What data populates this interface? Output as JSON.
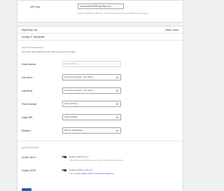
{
  "api": {
    "label": "API Key",
    "value": "xxxxxxxxxx12345 api-key-us1",
    "help": "Enter a MailChimp API key. You can create keys in your MailChimp account."
  },
  "list_panel": {
    "header_left": "MailChimp List",
    "header_right": "Fields Count",
    "list_name": "Monthly IT Newsletter"
  },
  "mapping": {
    "section_title": "MAP CUSTOM FIELDS",
    "section_sub": "Associate each MailChimp field with a Gravity Forms field.",
    "fields": [
      {
        "label": "Email Address",
        "value": "Email (Default)",
        "disabled": true
      },
      {
        "label": "First Name",
        "value": "First Name (Default - First Name)",
        "disabled": false
      },
      {
        "label": "Last Name",
        "value": "Last Name (Default - Last Name)",
        "disabled": false
      },
      {
        "label": "Phone Number",
        "value": "Phone (Phone)",
        "disabled": false
      },
      {
        "label": "Image URL",
        "value": "Avatar (Avatar)",
        "disabled": false
      },
      {
        "label": "Birthday *",
        "value": "Birthday (Datepicker)",
        "disabled": false
      }
    ]
  },
  "options": {
    "section_title": "EXTRA OPTIONS",
    "items": [
      {
        "label": "Double Opt-In",
        "text": "Enable double opt-in",
        "help": "If enabled, the user will receive an email to confirm the subscription.",
        "help_is_link": false
      },
      {
        "label": "Enable GDPR",
        "text": "Enable GDPR on this list",
        "help": "You must also enable GDPR on the list from MailChimp",
        "help_is_link": true
      }
    ]
  },
  "colors": {
    "accent": "#2a5db0",
    "toggle": "#1e1e1e",
    "background": "#eef0f2"
  },
  "icons": {
    "select_chevron": "chevron-down-icon"
  }
}
